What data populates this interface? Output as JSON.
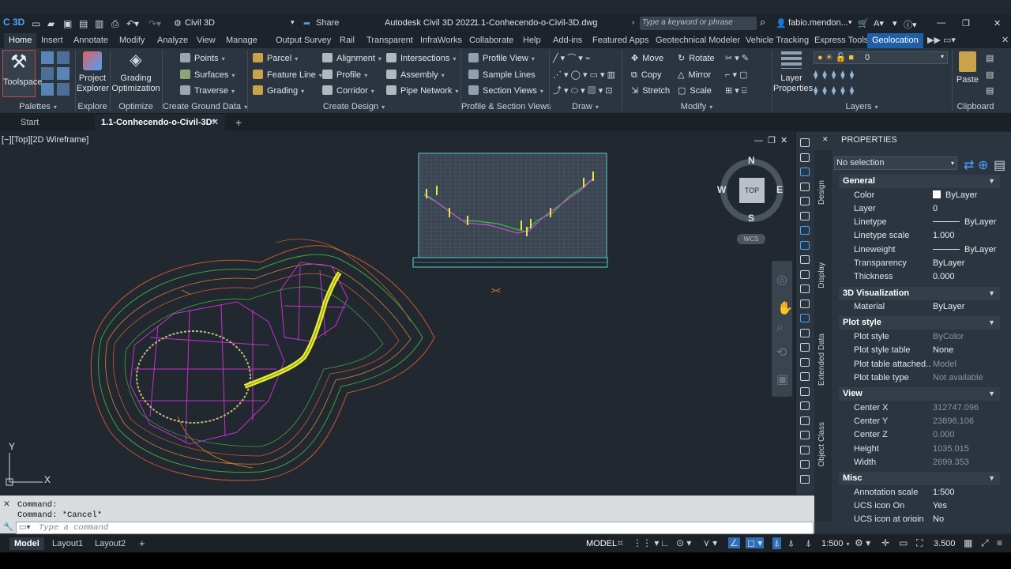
{
  "app": {
    "logo": "C 3D",
    "workspace": "Civil 3D",
    "share": "Share",
    "title": "Autodesk Civil 3D 2022",
    "file": "1.1-Conhecendo-o-Civil-3D.dwg",
    "search_placeholder": "Type a keyword or phrase",
    "user": "fabio.mendon..."
  },
  "ribbon_tabs": [
    "Home",
    "Insert",
    "Annotate",
    "Modify",
    "Analyze",
    "View",
    "Manage",
    "Output",
    "Survey",
    "Rail",
    "Transparent",
    "InfraWorks",
    "Collaborate",
    "Help",
    "Add-ins",
    "Featured Apps",
    "Geotechnical Modeler",
    "Vehicle Tracking",
    "Express Tools",
    "Geolocation"
  ],
  "panels": {
    "palettes": "Palettes",
    "explore": "Explore",
    "optimize": "Optimize",
    "ground": "Create Ground Data",
    "design": "Create Design",
    "profile": "Profile & Section Views",
    "draw": "Draw",
    "modify": "Modify",
    "layers": "Layers",
    "clipboard": "Clipboard"
  },
  "buttons": {
    "toolspace": "Toolspace",
    "project_explorer": "Project Explorer",
    "grading_optimization": "Grading Optimization",
    "points": "Points",
    "surfaces": "Surfaces",
    "traverse": "Traverse",
    "parcel": "Parcel",
    "feature_line": "Feature Line",
    "grading": "Grading",
    "alignment": "Alignment",
    "profile": "Profile",
    "corridor": "Corridor",
    "intersections": "Intersections",
    "assembly": "Assembly",
    "pipe_network": "Pipe Network",
    "profile_view": "Profile View",
    "sample_lines": "Sample Lines",
    "section_views": "Section Views",
    "move": "Move",
    "rotate": "Rotate",
    "copy": "Copy",
    "mirror": "Mirror",
    "stretch": "Stretch",
    "scale": "Scale",
    "layer_properties": "Layer Properties",
    "layer_value": "0",
    "paste": "Paste"
  },
  "doc_tabs": {
    "start": "Start",
    "active": "1.1-Conhecendo-o-Civil-3D*"
  },
  "viewport": {
    "label": "[−][Top][2D Wireframe]",
    "compass": {
      "n": "N",
      "s": "S",
      "e": "E",
      "w": "W",
      "top": "TOP",
      "wcs": "WCS"
    },
    "ucs": {
      "x": "X",
      "y": "Y"
    }
  },
  "properties": {
    "header": "PROPERTIES",
    "selection": "No selection",
    "side_tabs": [
      "Design",
      "Display",
      "Extended Data",
      "Object Class"
    ],
    "categories": [
      {
        "name": "General",
        "rows": [
          [
            "Color",
            "ByLayer"
          ],
          [
            "Layer",
            "0"
          ],
          [
            "Linetype",
            "ByLayer"
          ],
          [
            "Linetype scale",
            "1.000"
          ],
          [
            "Lineweight",
            "ByLayer"
          ],
          [
            "Transparency",
            "ByLayer"
          ],
          [
            "Thickness",
            "0.000"
          ]
        ]
      },
      {
        "name": "3D Visualization",
        "rows": [
          [
            "Material",
            "ByLayer"
          ]
        ]
      },
      {
        "name": "Plot style",
        "rows": [
          [
            "Plot style",
            "ByColor"
          ],
          [
            "Plot style table",
            "None"
          ],
          [
            "Plot table attached...",
            "Model"
          ],
          [
            "Plot table type",
            "Not available"
          ]
        ]
      },
      {
        "name": "View",
        "rows": [
          [
            "Center X",
            "312747.096"
          ],
          [
            "Center Y",
            "23896.106"
          ],
          [
            "Center Z",
            "0.000"
          ],
          [
            "Height",
            "1035.015"
          ],
          [
            "Width",
            "2699.353"
          ]
        ]
      },
      {
        "name": "Misc",
        "rows": [
          [
            "Annotation scale",
            "1:500"
          ],
          [
            "UCS icon On",
            "Yes"
          ],
          [
            "UCS icon at origin",
            "No"
          ]
        ]
      }
    ]
  },
  "command": {
    "history1": "Command:",
    "history2": "Command: *Cancel*",
    "placeholder": "Type a command"
  },
  "status": {
    "layouts": [
      "Model",
      "Layout1",
      "Layout2"
    ],
    "model": "MODEL",
    "scale": "1:500",
    "value": "3.500"
  }
}
